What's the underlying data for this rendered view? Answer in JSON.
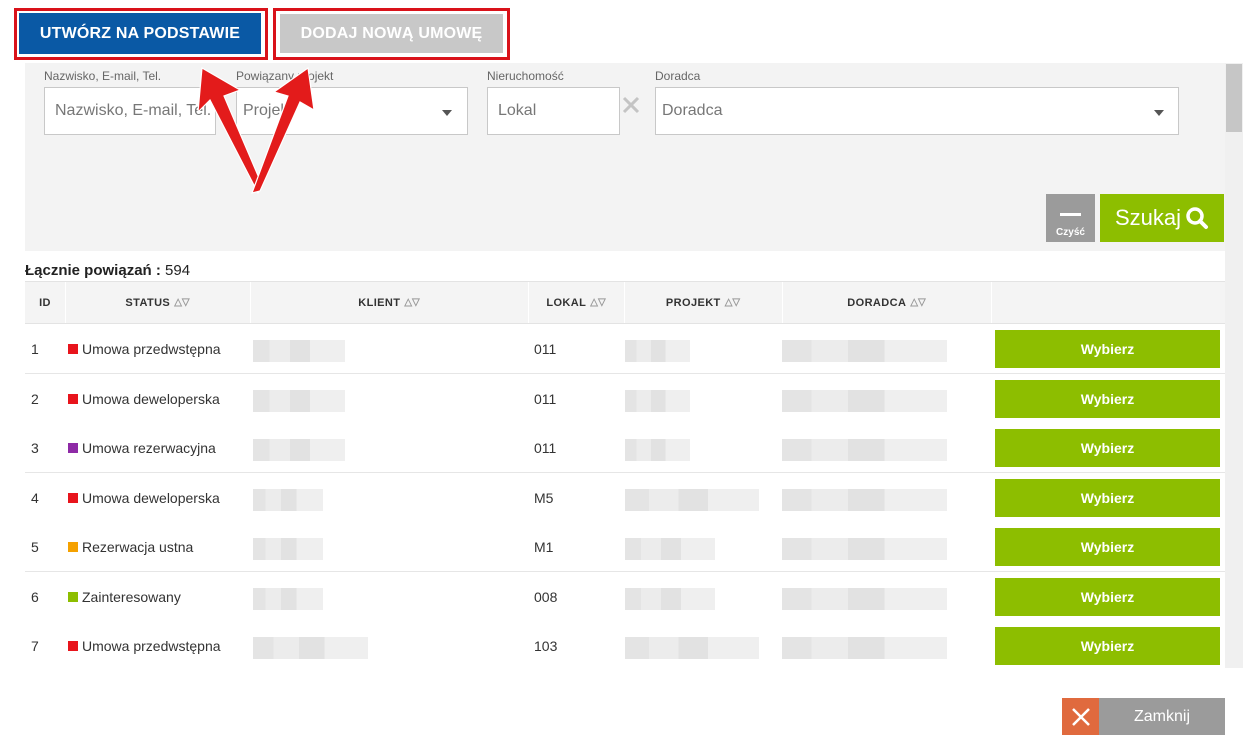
{
  "toolbar": {
    "create_based_label": "UTWÓRZ NA PODSTAWIE",
    "add_contract_label": "DODAJ NOWĄ UMOWĘ"
  },
  "filters": {
    "client": {
      "label": "Nazwisko, E-mail, Tel.",
      "placeholder": "Nazwisko, E-mail, Tel."
    },
    "project": {
      "label": "Powiązany projekt",
      "placeholder": "Projekt"
    },
    "property": {
      "label": "Nieruchomość",
      "placeholder": "Lokal"
    },
    "advisor": {
      "label": "Doradca",
      "placeholder": "Doradca"
    },
    "clear_label": "Czyść",
    "search_label": "Szukaj"
  },
  "summary": {
    "label": "Łącznie powiązań :",
    "count": "594"
  },
  "table": {
    "columns": [
      "ID",
      "STATUS",
      "KLIENT",
      "LOKAL",
      "PROJEKT",
      "DORADCA"
    ],
    "rows": [
      {
        "id": "1",
        "status": "Umowa przedwstępna",
        "status_color": "#e8141c",
        "lokal": "011",
        "action": "Wybierz"
      },
      {
        "id": "2",
        "status": "Umowa deweloperska",
        "status_color": "#e8141c",
        "lokal": "011",
        "action": "Wybierz"
      },
      {
        "id": "3",
        "status": "Umowa rezerwacyjna",
        "status_color": "#8e2aa6",
        "lokal": "011",
        "action": "Wybierz"
      },
      {
        "id": "4",
        "status": "Umowa deweloperska",
        "status_color": "#e8141c",
        "lokal": "M5",
        "action": "Wybierz"
      },
      {
        "id": "5",
        "status": "Rezerwacja ustna",
        "status_color": "#f5a100",
        "lokal": "M1",
        "action": "Wybierz"
      },
      {
        "id": "6",
        "status": "Zainteresowany",
        "status_color": "#8dbe00",
        "lokal": "008",
        "action": "Wybierz"
      },
      {
        "id": "7",
        "status": "Umowa przedwstępna",
        "status_color": "#e8141c",
        "lokal": "103",
        "action": "Wybierz"
      }
    ]
  },
  "footer": {
    "close_label": "Zamknij"
  },
  "colors": {
    "primary": "#0a59a5",
    "accent": "#8dbe00",
    "highlight": "#d9121a",
    "close": "#e06a3e"
  }
}
